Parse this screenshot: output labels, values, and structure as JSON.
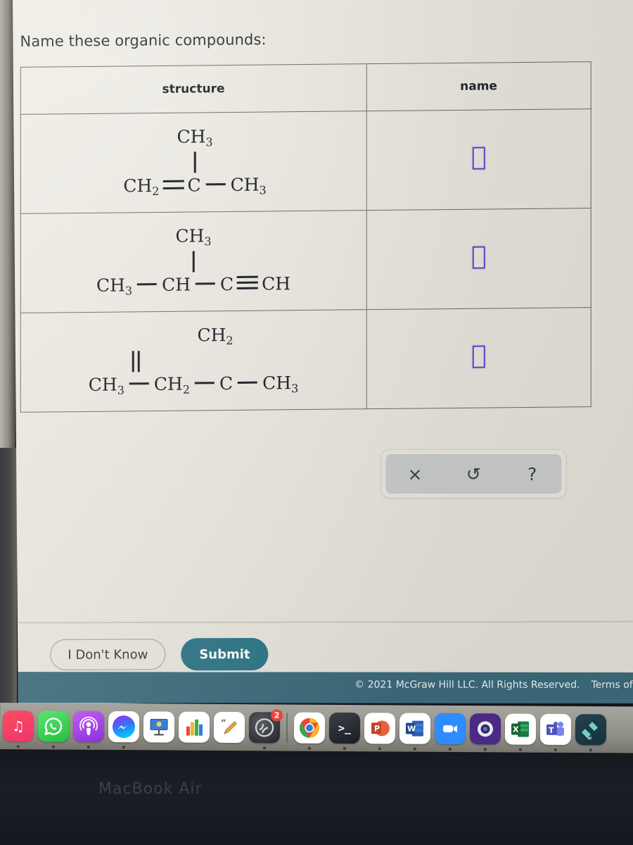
{
  "prompt": "Name these organic compounds:",
  "table": {
    "headers": [
      "structure",
      "name"
    ],
    "rows": [
      {
        "branch": "CH",
        "branch_sub": "3",
        "branch_bond": "single",
        "chain": [
          {
            "label": "CH",
            "sub": "2"
          },
          {
            "bond": "double"
          },
          {
            "label": "C",
            "sub": ""
          },
          {
            "bond": "single"
          },
          {
            "label": "CH",
            "sub": "3"
          }
        ],
        "answer_value": ""
      },
      {
        "branch": "CH",
        "branch_sub": "3",
        "branch_bond": "single",
        "chain": [
          {
            "label": "CH",
            "sub": "3"
          },
          {
            "bond": "single"
          },
          {
            "label": "CH",
            "sub": ""
          },
          {
            "bond": "single"
          },
          {
            "label": "C",
            "sub": ""
          },
          {
            "bond": "triple"
          },
          {
            "label": "CH",
            "sub": ""
          }
        ],
        "answer_value": ""
      },
      {
        "branch": "CH",
        "branch_sub": "2",
        "branch_bond": "double",
        "chain": [
          {
            "label": "CH",
            "sub": "3"
          },
          {
            "bond": "single"
          },
          {
            "label": "CH",
            "sub": "2"
          },
          {
            "bond": "single"
          },
          {
            "label": "C",
            "sub": ""
          },
          {
            "bond": "single"
          },
          {
            "label": "CH",
            "sub": "3"
          }
        ],
        "answer_value": ""
      }
    ]
  },
  "toolbar": {
    "clear_label": "×",
    "undo_label": "↺",
    "help_label": "?"
  },
  "actions": {
    "dont_know_label": "I Don't Know",
    "submit_label": "Submit"
  },
  "footer": {
    "copyright": "© 2021 McGraw Hill LLC. All Rights Reserved.",
    "terms": "Terms of"
  },
  "device": {
    "model_label": "MacBook Air"
  },
  "colors": {
    "answer_border": "#5a47d0",
    "submit_bg": "#2c7486",
    "footer_bg": "#3c6a7a",
    "page_bg": "#eae7df",
    "table_border": "#6e6a63"
  },
  "dock": {
    "items": [
      {
        "name": "music-icon",
        "label": "♫",
        "cls": "ic-music",
        "running": true
      },
      {
        "name": "whatsapp-icon",
        "label": "",
        "cls": "ic-whats",
        "running": true
      },
      {
        "name": "podcasts-icon",
        "label": "",
        "cls": "ic-pod",
        "running": true
      },
      {
        "name": "messenger-icon",
        "label": "",
        "cls": "ic-msgr",
        "running": true
      },
      {
        "name": "keynote-icon",
        "label": "",
        "cls": "ic-key",
        "running": false
      },
      {
        "name": "numbers-icon",
        "label": "",
        "cls": "ic-num",
        "running": false
      },
      {
        "name": "pages-icon",
        "label": "",
        "cls": "ic-pages",
        "running": false
      },
      {
        "name": "discord-icon",
        "label": "",
        "cls": "ic-disc",
        "running": true,
        "badge": "2"
      },
      {
        "name": "chrome-icon",
        "label": "",
        "cls": "ic-chrome",
        "running": true
      },
      {
        "name": "terminal-icon",
        "label": ">_",
        "cls": "ic-term",
        "running": true
      },
      {
        "name": "powerpoint-icon",
        "label": "P",
        "cls": "ic-ppt",
        "running": true
      },
      {
        "name": "word-icon",
        "label": "W",
        "cls": "ic-word",
        "running": true
      },
      {
        "name": "zoom-icon",
        "label": "",
        "cls": "ic-zoom",
        "running": true
      },
      {
        "name": "obs-icon",
        "label": "",
        "cls": "ic-obs",
        "running": true
      },
      {
        "name": "excel-icon",
        "label": "X",
        "cls": "ic-excel",
        "running": true
      },
      {
        "name": "teams-icon",
        "label": "T",
        "cls": "ic-teams",
        "running": true
      },
      {
        "name": "wix-icon",
        "label": "",
        "cls": "ic-wix",
        "running": true
      }
    ]
  }
}
